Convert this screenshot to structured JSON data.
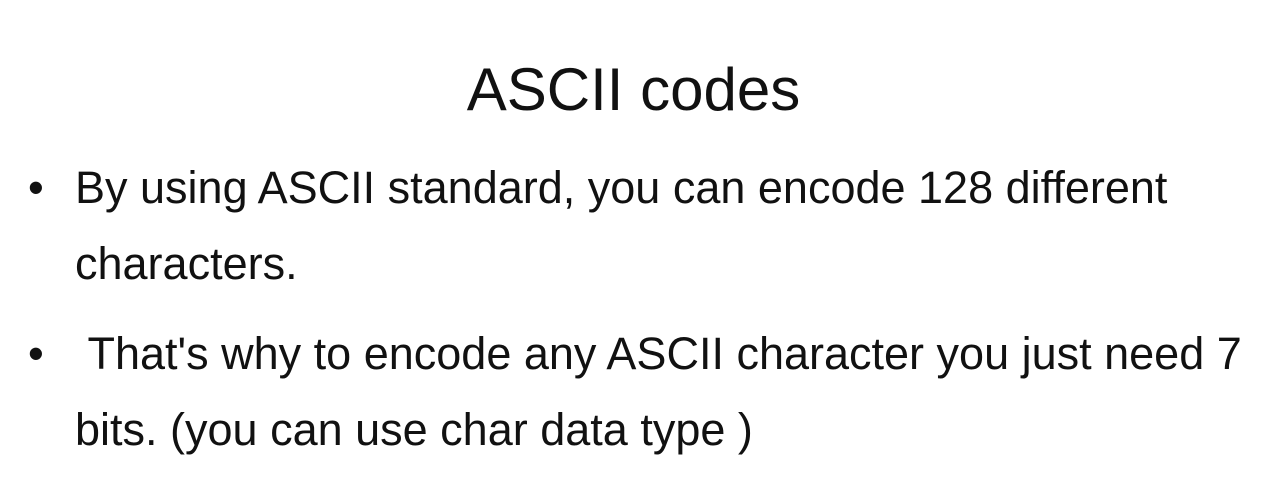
{
  "slide": {
    "title": "ASCII codes",
    "bullets": [
      {
        "marker": "•",
        "text": "By using ASCII standard, you can encode 128 different characters."
      },
      {
        "marker": "•",
        "text": " That's why to encode any ASCII character you just need 7 bits. (you can use char data type )"
      }
    ]
  }
}
